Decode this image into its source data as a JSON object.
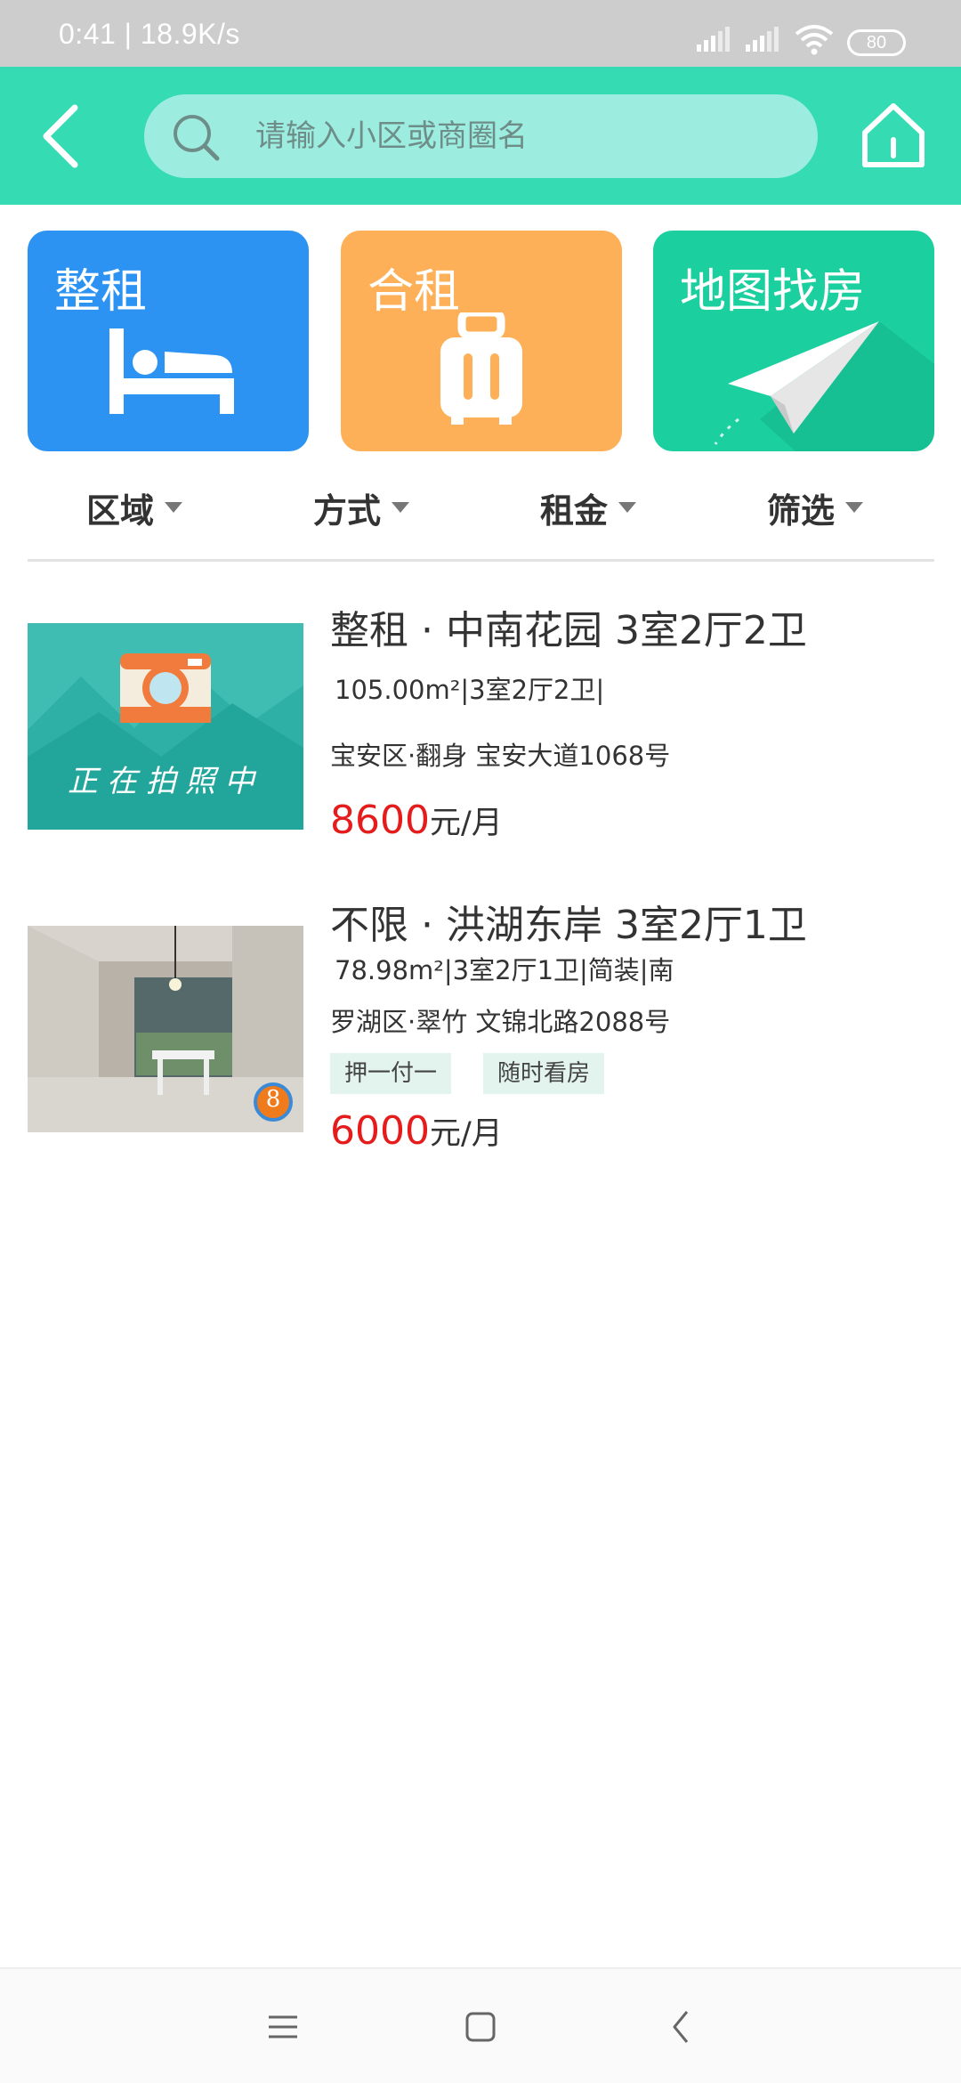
{
  "status_bar": {
    "time": "0:41 | 18.9K/s",
    "battery": "80"
  },
  "header": {
    "back_icon": "chevron-left-icon",
    "search_placeholder": "请输入小区或商圈名",
    "home_icon": "home-icon",
    "accent_color": "#35dcb3"
  },
  "categories": [
    {
      "label": "整租",
      "icon": "bed-icon",
      "color": "#2d93f3"
    },
    {
      "label": "合租",
      "icon": "luggage-icon",
      "color": "#fdb057"
    },
    {
      "label": "地图找房",
      "icon": "paper-plane-icon",
      "color": "#1ccf9f"
    }
  ],
  "filters": [
    {
      "label": "区域"
    },
    {
      "label": "方式"
    },
    {
      "label": "租金"
    },
    {
      "label": "筛选"
    }
  ],
  "listings": [
    {
      "title": "整租 · 中南花园 3室2厅2卫",
      "spec": "105.00m²|3室2厅2卫|",
      "address": "宝安区·翻身 宝安大道1068号",
      "tags": [],
      "price": "8600",
      "price_unit": "元/月",
      "thumb_caption": "正在拍照中"
    },
    {
      "title": "不限 · 洪湖东岸 3室2厅1卫",
      "spec": "78.98m²|3室2厅1卫|简装|南",
      "address": "罗湖区·翠竹 文锦北路2088号",
      "tags": [
        "押一付一",
        "随时看房"
      ],
      "price": "6000",
      "price_unit": "元/月",
      "thumb_badge": "8"
    }
  ],
  "price_color": "#e51c1c"
}
